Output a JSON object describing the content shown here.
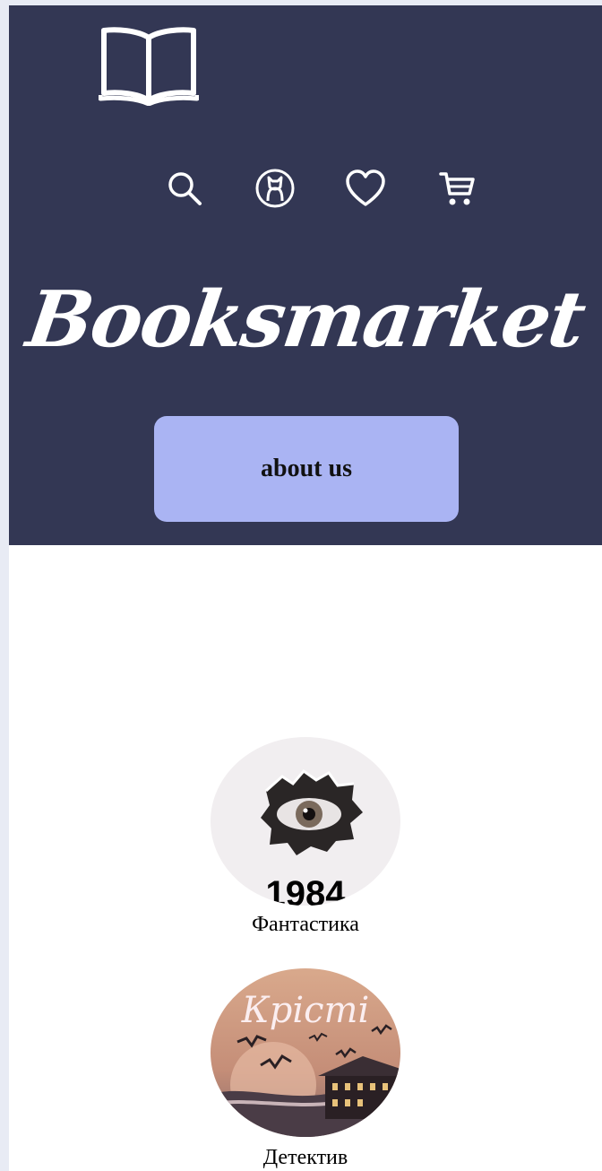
{
  "header": {
    "logo_icon": "open-book-icon",
    "icons": [
      "search-icon",
      "account-icon",
      "heart-icon",
      "cart-icon"
    ],
    "brand_title": "Booksmarket",
    "about_button": "about us",
    "background": "#333754",
    "button_color": "#aab4f3"
  },
  "categories": [
    {
      "label": "Фантастика",
      "image_text": "1984"
    },
    {
      "label": "Детектив",
      "image_text": "Крісті"
    }
  ]
}
